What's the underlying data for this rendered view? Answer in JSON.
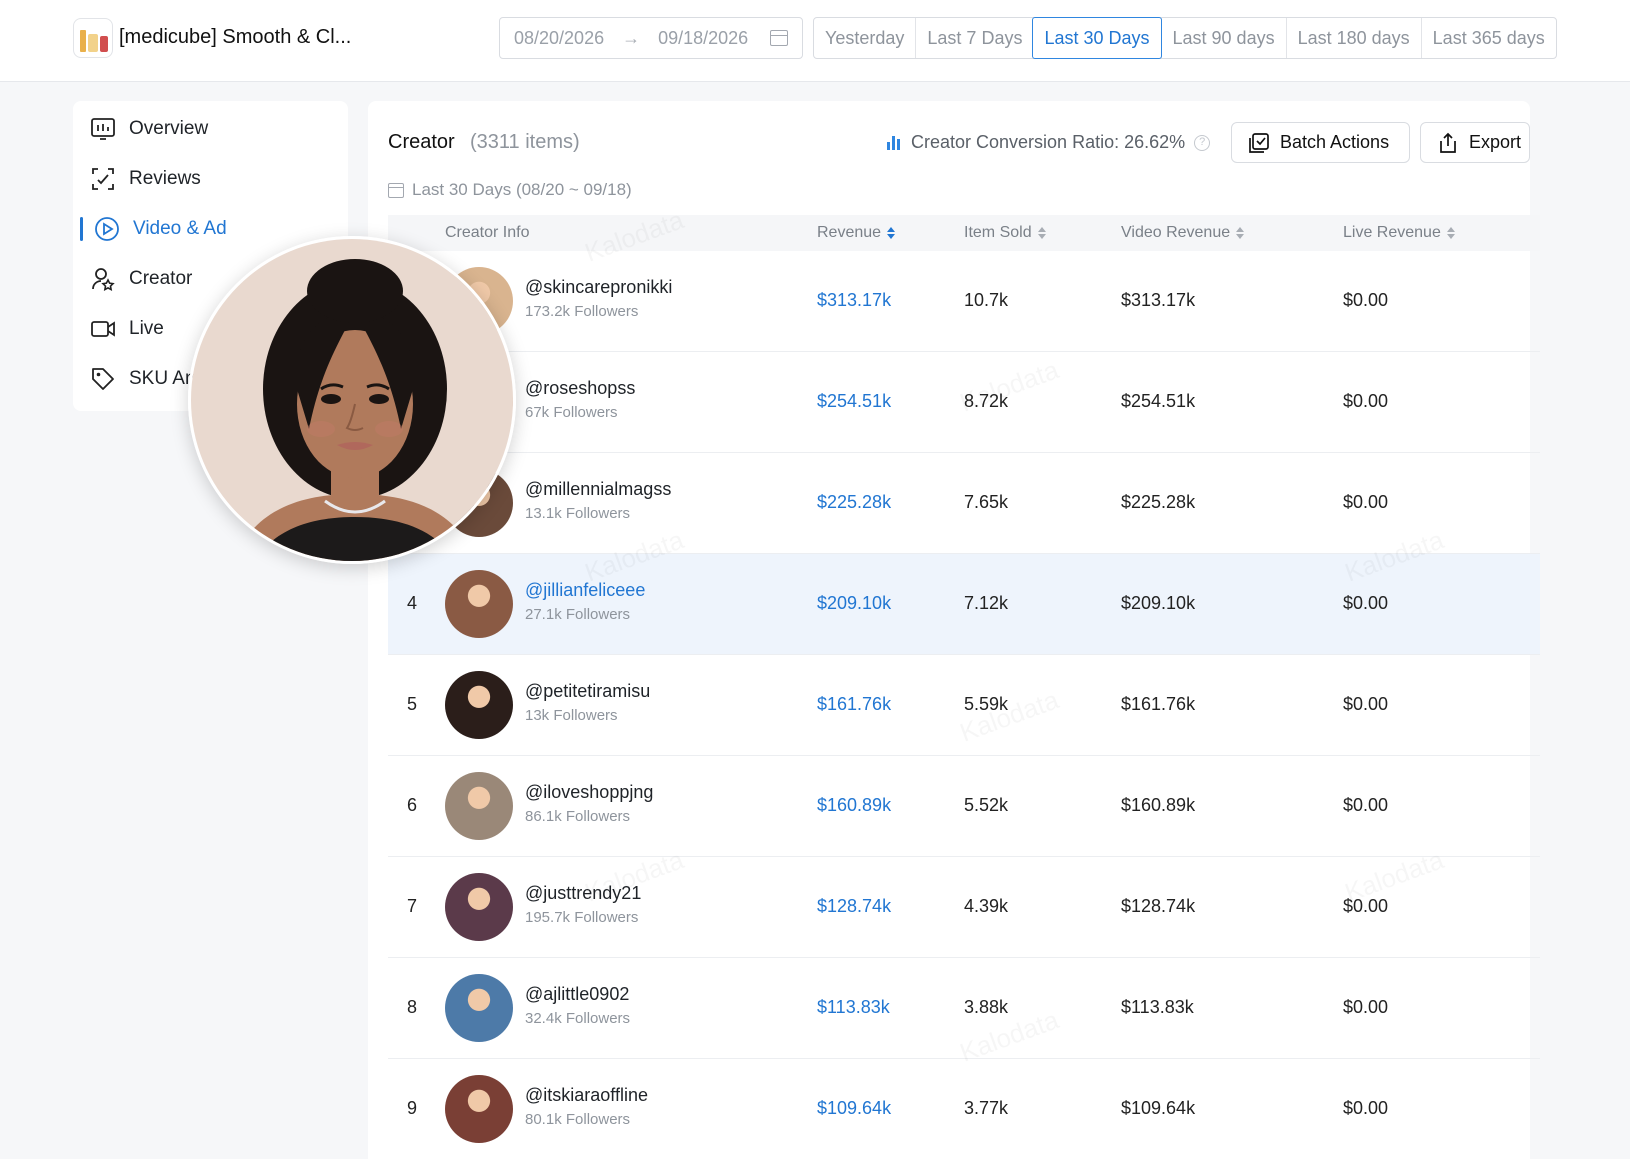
{
  "header": {
    "product_title": "[medicube] Smooth & Cl...",
    "date_start": "08/20/2026",
    "date_end": "09/18/2026",
    "quick_ranges": [
      {
        "label": "Yesterday",
        "active": false
      },
      {
        "label": "Last 7 Days",
        "active": false
      },
      {
        "label": "Last 30 Days",
        "active": true
      },
      {
        "label": "Last 90 days",
        "active": false
      },
      {
        "label": "Last 180 days",
        "active": false
      },
      {
        "label": "Last 365 days",
        "active": false
      }
    ]
  },
  "sidebar": {
    "items": [
      {
        "label": "Overview",
        "icon": "chart-board-icon",
        "active": false
      },
      {
        "label": "Reviews",
        "icon": "scan-review-icon",
        "active": false
      },
      {
        "label": "Video & Ad",
        "icon": "play-circle-icon",
        "active": true
      },
      {
        "label": "Creator",
        "icon": "user-star-icon",
        "active": false
      },
      {
        "label": "Live",
        "icon": "video-camera-icon",
        "active": false
      },
      {
        "label": "SKU Ana",
        "icon": "tag-icon",
        "active": false
      }
    ]
  },
  "main": {
    "title": "Creator",
    "count": "(3311 items)",
    "conversion_label": "Creator Conversion Ratio: 26.62%",
    "batch_label": "Batch Actions",
    "export_label": "Export",
    "period": "Last 30 Days (08/20 ~ 09/18)",
    "watermark": "Kalodata",
    "columns": {
      "creator": "Creator Info",
      "revenue": "Revenue",
      "sold": "Item Sold",
      "video_revenue": "Video Revenue",
      "live_revenue": "Live Revenue"
    },
    "rows": [
      {
        "rank": "",
        "handle": "@skincarepronikki",
        "followers": "173.2k Followers",
        "revenue": "$313.17k",
        "sold": "10.7k",
        "video_revenue": "$313.17k",
        "live_revenue": "$0.00",
        "avatar_color": "#d9b48f",
        "highlight": false
      },
      {
        "rank": "",
        "handle": "@roseshopss",
        "followers": "67k Followers",
        "revenue": "$254.51k",
        "sold": "8.72k",
        "video_revenue": "$254.51k",
        "live_revenue": "$0.00",
        "avatar_color": "#c99b7e",
        "highlight": false
      },
      {
        "rank": "",
        "handle": "@millennialmagss",
        "followers": "13.1k Followers",
        "revenue": "$225.28k",
        "sold": "7.65k",
        "video_revenue": "$225.28k",
        "live_revenue": "$0.00",
        "avatar_color": "#6a4a3a",
        "highlight": false
      },
      {
        "rank": "4",
        "handle": "@jillianfeliceee",
        "followers": "27.1k Followers",
        "revenue": "$209.10k",
        "sold": "7.12k",
        "video_revenue": "$209.10k",
        "live_revenue": "$0.00",
        "avatar_color": "#8a5a44",
        "highlight": true
      },
      {
        "rank": "5",
        "handle": "@petitetiramisu",
        "followers": "13k Followers",
        "revenue": "$161.76k",
        "sold": "5.59k",
        "video_revenue": "$161.76k",
        "live_revenue": "$0.00",
        "avatar_color": "#2b1e1a",
        "highlight": false
      },
      {
        "rank": "6",
        "handle": "@iloveshoppjng",
        "followers": "86.1k Followers",
        "revenue": "$160.89k",
        "sold": "5.52k",
        "video_revenue": "$160.89k",
        "live_revenue": "$0.00",
        "avatar_color": "#9a8878",
        "highlight": false
      },
      {
        "rank": "7",
        "handle": "@justtrendy21",
        "followers": "195.7k Followers",
        "revenue": "$128.74k",
        "sold": "4.39k",
        "video_revenue": "$128.74k",
        "live_revenue": "$0.00",
        "avatar_color": "#5b3a4a",
        "highlight": false
      },
      {
        "rank": "8",
        "handle": "@ajlittle0902",
        "followers": "32.4k Followers",
        "revenue": "$113.83k",
        "sold": "3.88k",
        "video_revenue": "$113.83k",
        "live_revenue": "$0.00",
        "avatar_color": "#4d7aa8",
        "highlight": false
      },
      {
        "rank": "9",
        "handle": "@itskiaraoffline",
        "followers": "80.1k Followers",
        "revenue": "$109.64k",
        "sold": "3.77k",
        "video_revenue": "$109.64k",
        "live_revenue": "$0.00",
        "avatar_color": "#7a3f35",
        "highlight": false
      }
    ]
  },
  "popup": {
    "subject": "creator-avatar-preview",
    "bg_color": "#e9d9cf",
    "skin_color": "#b07a5c",
    "hair_color": "#1a1412"
  }
}
